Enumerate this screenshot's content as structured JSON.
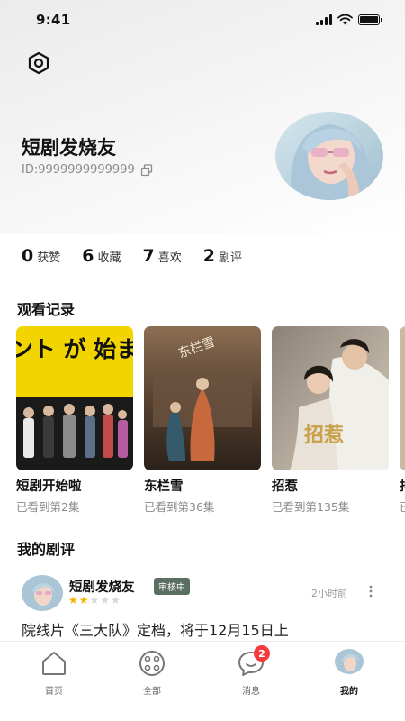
{
  "status_bar": {
    "time": "9:41"
  },
  "profile": {
    "username": "短剧发烧友",
    "user_id": "ID:9999999999999",
    "stats": [
      {
        "value": "0",
        "label": "获赞"
      },
      {
        "value": "6",
        "label": "收藏"
      },
      {
        "value": "7",
        "label": "喜欢"
      },
      {
        "value": "2",
        "label": "剧评"
      }
    ]
  },
  "watch_history": {
    "title": "观看记录",
    "items": [
      {
        "title": "短剧开始啦",
        "progress": "已看到第2集",
        "poster_text": "コント が 始まる"
      },
      {
        "title": "东栏雪",
        "progress": "已看到第36集",
        "poster_text": "东栏雪"
      },
      {
        "title": "招惹",
        "progress": "已看到第135集",
        "poster_text": "招惹"
      },
      {
        "title": "抖",
        "progress": "已",
        "poster_text": ""
      }
    ]
  },
  "reviews": {
    "title": "我的剧评",
    "items": [
      {
        "author": "短剧发烧友",
        "badge": "审核中",
        "rating": 2,
        "max_rating": 5,
        "time": "2小时前",
        "text": "院线片《三大队》定档，将于12月15日上"
      }
    ]
  },
  "tab_bar": {
    "items": [
      {
        "label": "首页",
        "icon": "home-icon"
      },
      {
        "label": "全部",
        "icon": "grid-icon"
      },
      {
        "label": "消息",
        "icon": "message-icon",
        "badge": "2"
      },
      {
        "label": "我的",
        "icon": "avatar-icon",
        "active": true
      }
    ]
  },
  "colors": {
    "badge_red": "#f43c3c",
    "review_badge_green": "#5b6e62",
    "star_gold": "#f4b400",
    "muted_text": "#8a8a8a"
  }
}
